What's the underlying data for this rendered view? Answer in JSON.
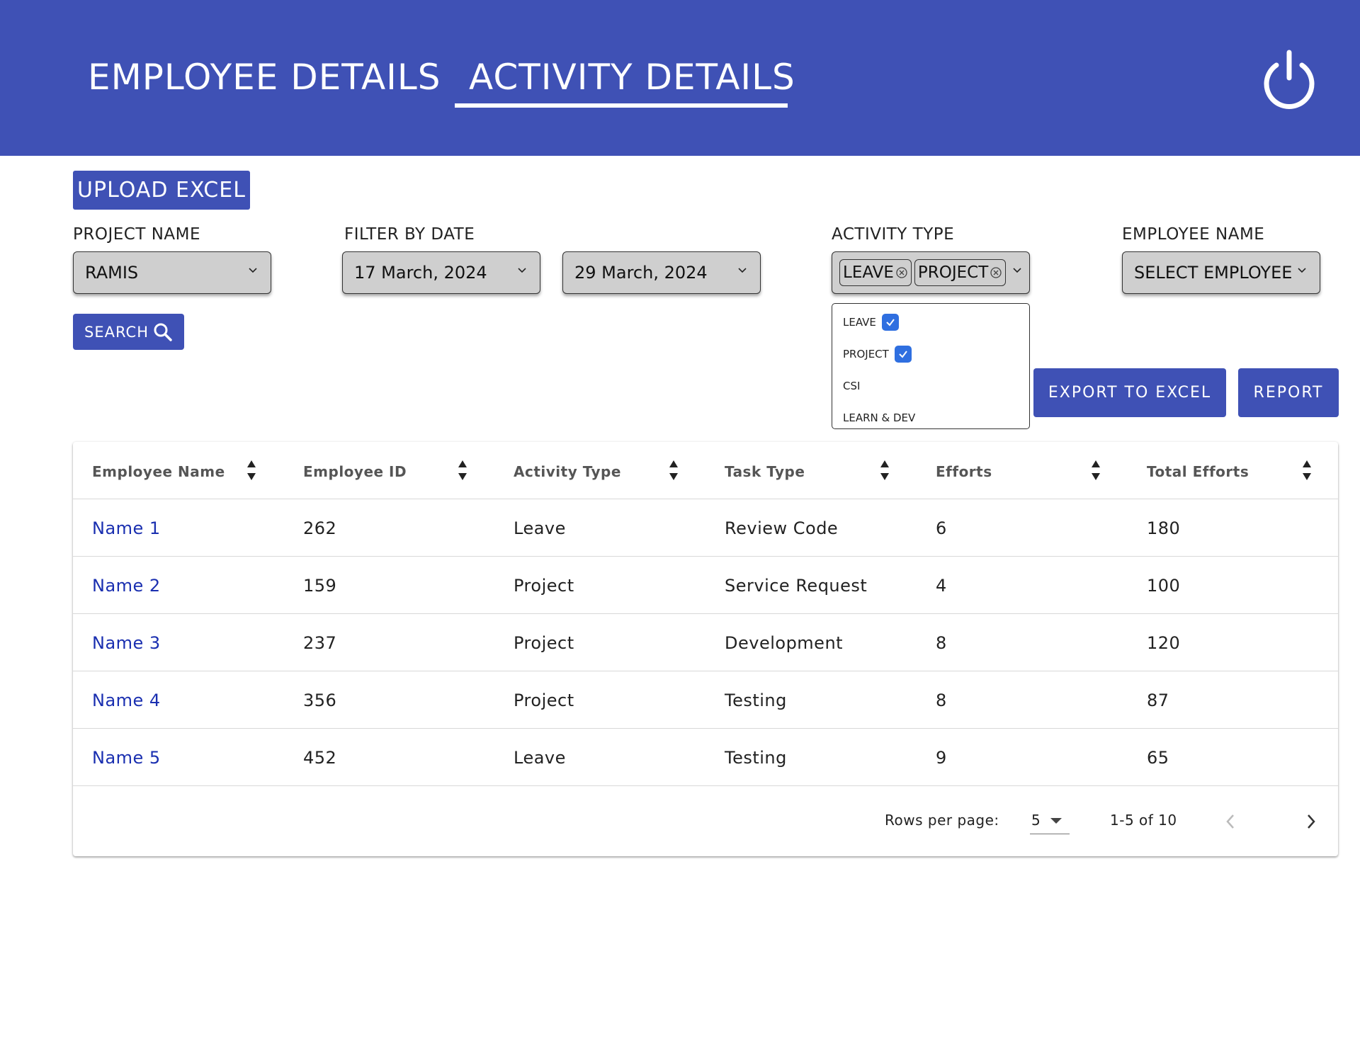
{
  "header": {
    "tabs": [
      {
        "label": "EMPLOYEE DETAILS"
      },
      {
        "label": "ACTIVITY DETAILS"
      }
    ],
    "active_tab": "ACTIVITY DETAILS",
    "power_icon": "power-icon",
    "background_color": "#3f51b5"
  },
  "toolbar": {
    "upload_label": "UPLOAD EXCEL",
    "search_label": "SEARCH",
    "export_label": "EXPORT TO EXCEL",
    "report_label": "REPORT"
  },
  "filters": {
    "project_label": "PROJECT NAME",
    "project_value": "RAMIS",
    "date_label": "FILTER BY DATE",
    "date_from": "17 March, 2024",
    "date_to": "29 March, 2024",
    "activity_label": "ACTIVITY TYPE",
    "activity_chips": [
      "LEAVE",
      "PROJECT"
    ],
    "employee_label": "EMPLOYEE NAME",
    "employee_value": "SELECT EMPLOYEE"
  },
  "activity_dropdown": {
    "options": [
      {
        "label": "LEAVE",
        "checked": true
      },
      {
        "label": "PROJECT",
        "checked": true
      },
      {
        "label": "CSI",
        "checked": false
      },
      {
        "label": "LEARN & DEV",
        "checked": false
      }
    ]
  },
  "table": {
    "columns": [
      "Employee Name",
      "Employee ID",
      "Activity Type",
      "Task Type",
      "Efforts",
      "Total Efforts"
    ],
    "rows": [
      [
        "Name 1",
        "262",
        "Leave",
        "Review Code",
        "6",
        "180"
      ],
      [
        "Name 2",
        "159",
        "Project",
        "Service Request",
        "4",
        "100"
      ],
      [
        "Name 3",
        "237",
        "Project",
        "Development",
        "8",
        "120"
      ],
      [
        "Name 4",
        "356",
        "Project",
        "Testing",
        "8",
        "87"
      ],
      [
        "Name 5",
        "452",
        "Leave",
        "Testing",
        "9",
        "65"
      ]
    ]
  },
  "pagination": {
    "rows_per_page_label": "Rows per page:",
    "rows_per_page_value": "5",
    "range": "1-5 of 10"
  },
  "colors": {
    "primary": "#3f51b5",
    "link": "#1a2fb0",
    "checkbox": "#2f6fe0"
  }
}
